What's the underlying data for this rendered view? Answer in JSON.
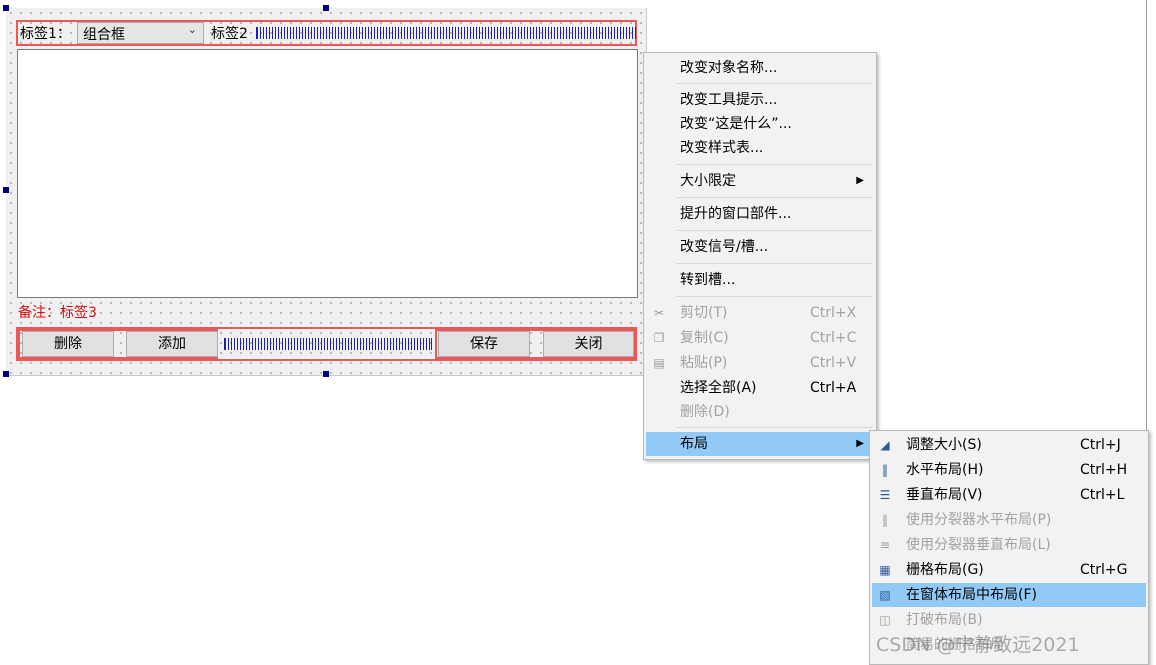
{
  "form": {
    "label1": "标签1：",
    "combo_value": "组合框",
    "label2": "标签2",
    "note": "备注：标签3",
    "buttons": {
      "delete": "删除",
      "add": "添加",
      "save": "保存",
      "close": "关闭"
    }
  },
  "context_menu": {
    "items": {
      "rename": "改变对象名称...",
      "tooltip": "改变工具提示...",
      "whatsthis": "改变“这是什么”...",
      "stylesheet": "改变样式表...",
      "size_constraints": "大小限定",
      "promoted": "提升的窗口部件...",
      "signals": "改变信号/槽...",
      "goto_slot": "转到槽...",
      "cut": "剪切(T)",
      "copy": "复制(C)",
      "paste": "粘贴(P)",
      "select_all": "选择全部(A)",
      "delete": "删除(D)",
      "layout": "布局"
    },
    "shortcuts": {
      "cut": "Ctrl+X",
      "copy": "Ctrl+C",
      "paste": "Ctrl+V",
      "select_all": "Ctrl+A"
    }
  },
  "layout_submenu": {
    "items": {
      "adjust_size": "调整大小(S)",
      "horizontal": "水平布局(H)",
      "vertical": "垂直布局(V)",
      "splitter_h": "使用分裂器水平布局(P)",
      "splitter_v": "使用分裂器垂直布局(L)",
      "grid": "栅格布局(G)",
      "form_layout": "在窗体布局中布局(F)",
      "break": "打破布局(B)",
      "simplify": "简易的栅格布局"
    },
    "shortcuts": {
      "adjust_size": "Ctrl+J",
      "horizontal": "Ctrl+H",
      "vertical": "Ctrl+L",
      "grid": "Ctrl+G"
    }
  },
  "watermark": "CSDN @宁静致远2021",
  "colors": {
    "layout_border": "#ee5757",
    "highlight": "#91c9f7",
    "note_text": "#d01010",
    "spacer": "#1e1eb4"
  }
}
